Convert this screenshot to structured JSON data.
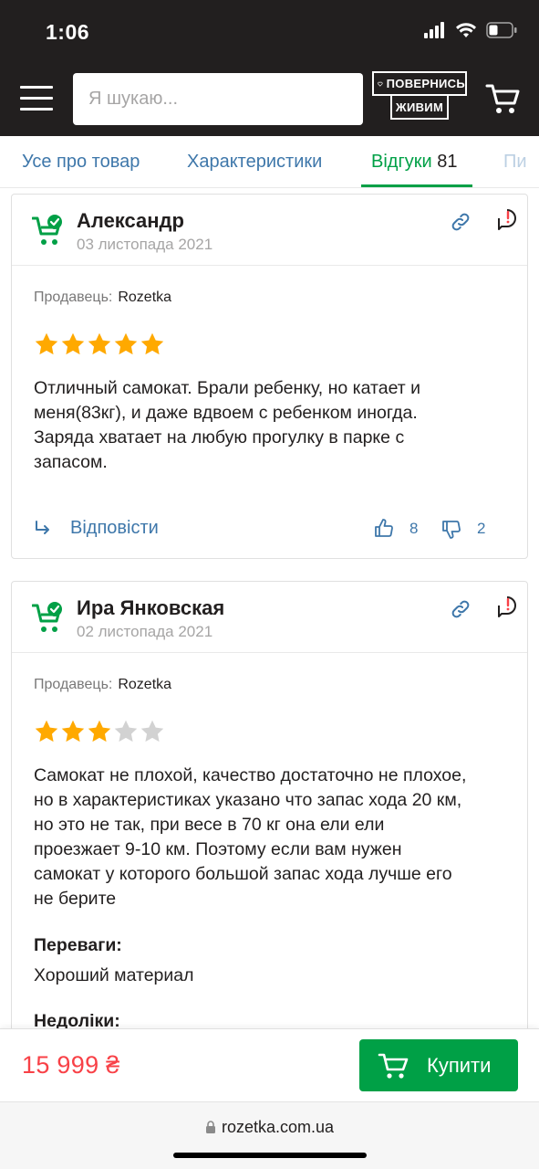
{
  "status": {
    "time": "1:06"
  },
  "header": {
    "search_placeholder": "Я шукаю...",
    "logo_line1": "ПОВЕРНИСЬ",
    "logo_line2": "ЖИВИМ"
  },
  "tabs": [
    {
      "label": "Усе про товар"
    },
    {
      "label": "Характеристики"
    },
    {
      "label": "Відгуки",
      "count": "81"
    },
    {
      "label": "Пи"
    }
  ],
  "reviews": [
    {
      "author": "Александр",
      "date": "03 листопада 2021",
      "seller_label": "Продавець:",
      "seller": "Rozetka",
      "rating": 5,
      "text_lines": [
        "Отличный самокат. Брали ребенку, но катает и",
        "меня(83кг), и даже вдвоем с ребенком иногда.",
        "Заряда хватает на любую прогулку в парке с",
        "запасом."
      ],
      "reply_label": "Відповісти",
      "likes": "8",
      "dislikes": "2"
    },
    {
      "author": "Ира Янковская",
      "date": "02 листопада 2021",
      "seller_label": "Продавець:",
      "seller": "Rozetka",
      "rating": 3,
      "text_lines": [
        "Самокат не плохой, качество достаточно не плохое,",
        "но в характеристиках указано что запас хода 20 км,",
        "но это не так, при весе в 70 кг она ели ели",
        "проезжает 9-10 км. Поэтому если вам нужен",
        "самокат у которого большой запас хода лучше его",
        "не берите"
      ],
      "pros_label": "Переваги:",
      "pros": "Хороший материал",
      "cons_label": "Недоліки:"
    }
  ],
  "buy": {
    "price": "15 999 ₴",
    "button_label": "Купити"
  },
  "browser": {
    "url": "rozetka.com.ua"
  },
  "colors": {
    "green": "#00a046",
    "link": "#3e77aa",
    "price": "#f84147",
    "star": "#ffa900",
    "star_empty": "#d2d2d2"
  }
}
